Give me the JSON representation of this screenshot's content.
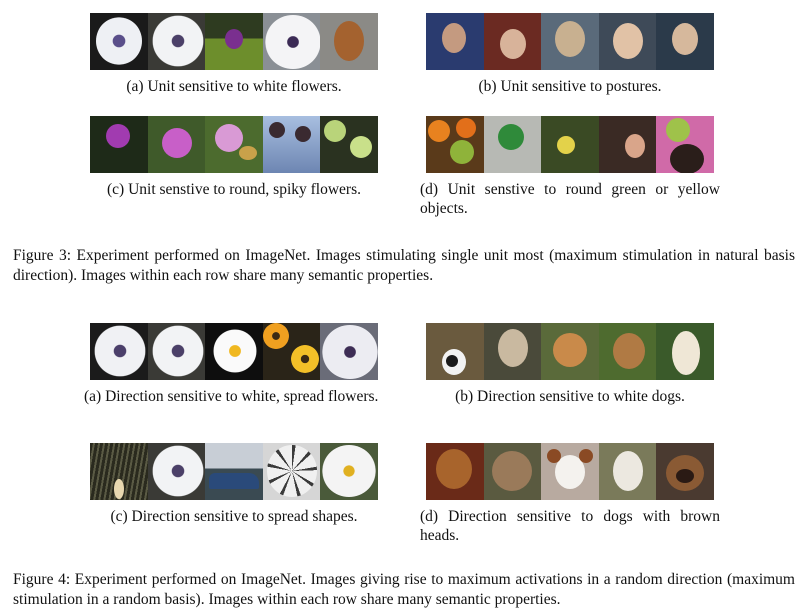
{
  "figure3": {
    "panels": [
      {
        "caption": "(a)  Unit sensitive to white flowers.",
        "images": [
          "white flower",
          "white flower",
          "purple flower in field",
          "white daisy",
          "brown puppy"
        ]
      },
      {
        "caption": "(b)  Unit sensitive to postures.",
        "images": [
          "person in headscarf",
          "child with hat",
          "person in helmet",
          "smiling child",
          "child in hoodie"
        ]
      },
      {
        "caption": "(c)  Unit senstive to round, spiky flowers.",
        "images": [
          "purple thistle",
          "pink thistle",
          "pink thistle with butterfly",
          "dark thistles against sky",
          "spiky green flowers"
        ]
      },
      {
        "caption": "(d)  Unit senstive to round green or yellow objects.",
        "images": [
          "oranges and limes",
          "green dial instrument",
          "yellow flower",
          "children",
          "person with green ball"
        ]
      }
    ],
    "caption": "Figure 3: Experiment performed on ImageNet. Images stimulating single unit most (maximum stimulation in natural basis direction). Images within each row share many semantic properties."
  },
  "figure4": {
    "panels": [
      {
        "caption": "(a)  Direction sensitive to white, spread flowers.",
        "images": [
          "white flower",
          "white daisy",
          "white flower on dark",
          "orange and yellow flowers",
          "white flower close up"
        ]
      },
      {
        "caption": "(b)  Direction sensitive to white dogs.",
        "images": [
          "black and white dog",
          "husky",
          "shiba dog",
          "beagle puppy",
          "white labrador"
        ]
      },
      {
        "caption": "(c)  Direction sensitive to spread shapes.",
        "images": [
          "peacock fan",
          "white daisy",
          "blue car",
          "fan blades",
          "white daisy"
        ]
      },
      {
        "caption": "(d)  Direction sensitive to dogs with brown heads.",
        "images": [
          "brown long-haired dog",
          "pomeranian",
          "papillon dog",
          "white terrier",
          "brown puppy"
        ]
      }
    ],
    "caption": "Figure 4: Experiment performed on ImageNet. Images giving rise to maximum activations in a random direction (maximum stimulation in a random basis). Images within each row share many semantic properties."
  }
}
